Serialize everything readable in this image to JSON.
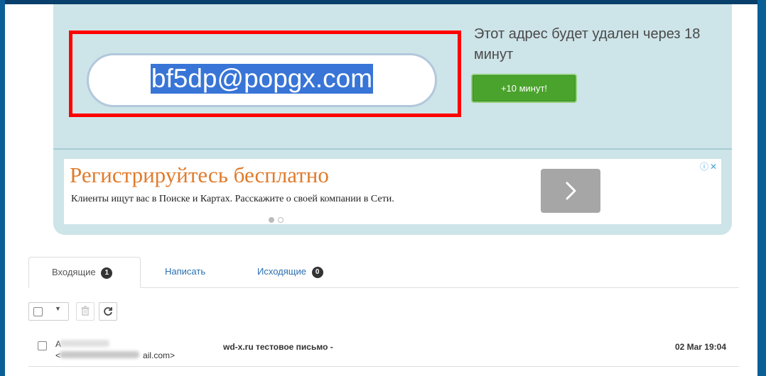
{
  "mailbox": {
    "address": "bf5dp@popgx.com",
    "expire_notice": "Этот адрес будет удален через 18 минут",
    "extend_button": "+10 минут!"
  },
  "ad": {
    "headline": "Регистрируйтесь бесплатно",
    "description": "Клиенты ищут вас в Поиске и Картах. Расскажите о своей компании в Сети.",
    "info_icons": "ⓘ✕"
  },
  "tabs": [
    {
      "label": "Входящие",
      "count": "1"
    },
    {
      "label": "Написать"
    },
    {
      "label": "Исходящие",
      "count": "0"
    }
  ],
  "toolbar": {
    "select_caret": "▼"
  },
  "messages": [
    {
      "sender_name": "A",
      "sender_email_prefix": "<",
      "sender_email_suffix": "ail.com>",
      "subject": "wd-x.ru тестовое письмо -",
      "date": "02 Mar 19:04"
    }
  ],
  "colors": {
    "frame": "#0b5f97",
    "panel": "#cde4e8",
    "highlight_box": "#ff0000",
    "selection": "#3875d7",
    "extend_button": "#4aa32c",
    "ad_headline": "#e07b2c",
    "link": "#2a6fb0"
  },
  "icons": [
    "chevron-right-icon",
    "trash-icon",
    "refresh-icon",
    "ad-info-icon",
    "ad-close-icon"
  ]
}
